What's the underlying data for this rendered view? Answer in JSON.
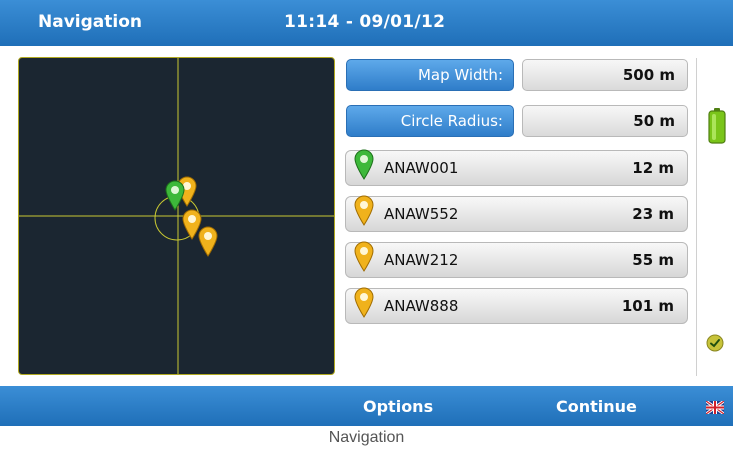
{
  "header": {
    "title": "Navigation",
    "datetime": "11:14 - 09/01/12"
  },
  "settings": {
    "map_width": {
      "label": "Map Width:",
      "value": "500 m"
    },
    "circle_radius": {
      "label": "Circle Radius:",
      "value": "50 m"
    }
  },
  "targets": [
    {
      "name": "ANAW001",
      "distance": "12 m",
      "pin_color": "#3db83a"
    },
    {
      "name": "ANAW552",
      "distance": "23 m",
      "pin_color": "#f0b21c"
    },
    {
      "name": "ANAW212",
      "distance": "55 m",
      "pin_color": "#f0b21c"
    },
    {
      "name": "ANAW888",
      "distance": "101 m",
      "pin_color": "#f0b21c"
    }
  ],
  "footer": {
    "options_label": "Options",
    "continue_label": "Continue"
  },
  "caption": "Navigation",
  "colors": {
    "bar_blue": "#2b7fcb",
    "map_bg": "#1b2631",
    "crosshair": "#c8c832",
    "battery": "#7ac51a"
  },
  "icons": {
    "battery": "battery-icon",
    "status": "check-icon",
    "language": "uk-flag-icon"
  }
}
